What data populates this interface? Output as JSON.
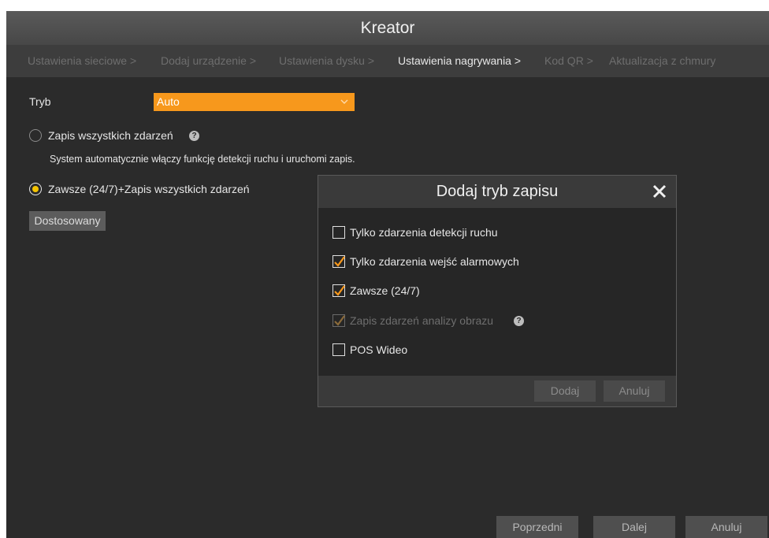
{
  "window": {
    "title": "Kreator"
  },
  "steps": [
    {
      "label": "Ustawienia sieciowe >"
    },
    {
      "label": "Dodaj urządzenie >"
    },
    {
      "label": "Ustawienia dysku >"
    },
    {
      "label": "Ustawienia nagrywania >"
    },
    {
      "label": "Kod QR >"
    },
    {
      "label": "Aktualizacja z chmury"
    }
  ],
  "active_step": "Ustawienia nagrywania >",
  "form": {
    "mode_label": "Tryb",
    "mode_value": "Auto",
    "option1_label": "Zapis wszystkich zdarzeń",
    "option1_selected": false,
    "option1_desc": "System automatycznie włączy funkcję detekcji ruchu i uruchomi zapis.",
    "option2_label": "Zawsze (24/7)+Zapis wszystkich zdarzeń",
    "option2_selected": true,
    "custom_button": "Dostosowany"
  },
  "dialog": {
    "title": "Dodaj tryb zapisu",
    "options": [
      {
        "label": "Tylko zdarzenia detekcji ruchu",
        "checked": false,
        "enabled": true
      },
      {
        "label": "Tylko zdarzenia wejść alarmowych",
        "checked": true,
        "enabled": true
      },
      {
        "label": "Zawsze (24/7)",
        "checked": true,
        "enabled": true
      },
      {
        "label": "Zapis zdarzeń analizy obrazu",
        "checked": true,
        "enabled": false
      },
      {
        "label": "POS Wideo",
        "checked": false,
        "enabled": true
      }
    ],
    "add_button": "Dodaj",
    "cancel_button": "Anuluj"
  },
  "footer": {
    "prev_button": "Poprzedni",
    "next_button": "Dalej",
    "cancel_button": "Anuluj"
  },
  "colors": {
    "accent": "#f7981c",
    "radio_selected": "#f5c400",
    "background": "#2b2b2b"
  },
  "icons": [
    "chevron-down-icon",
    "help-icon",
    "close-icon",
    "checkmark-icon"
  ]
}
